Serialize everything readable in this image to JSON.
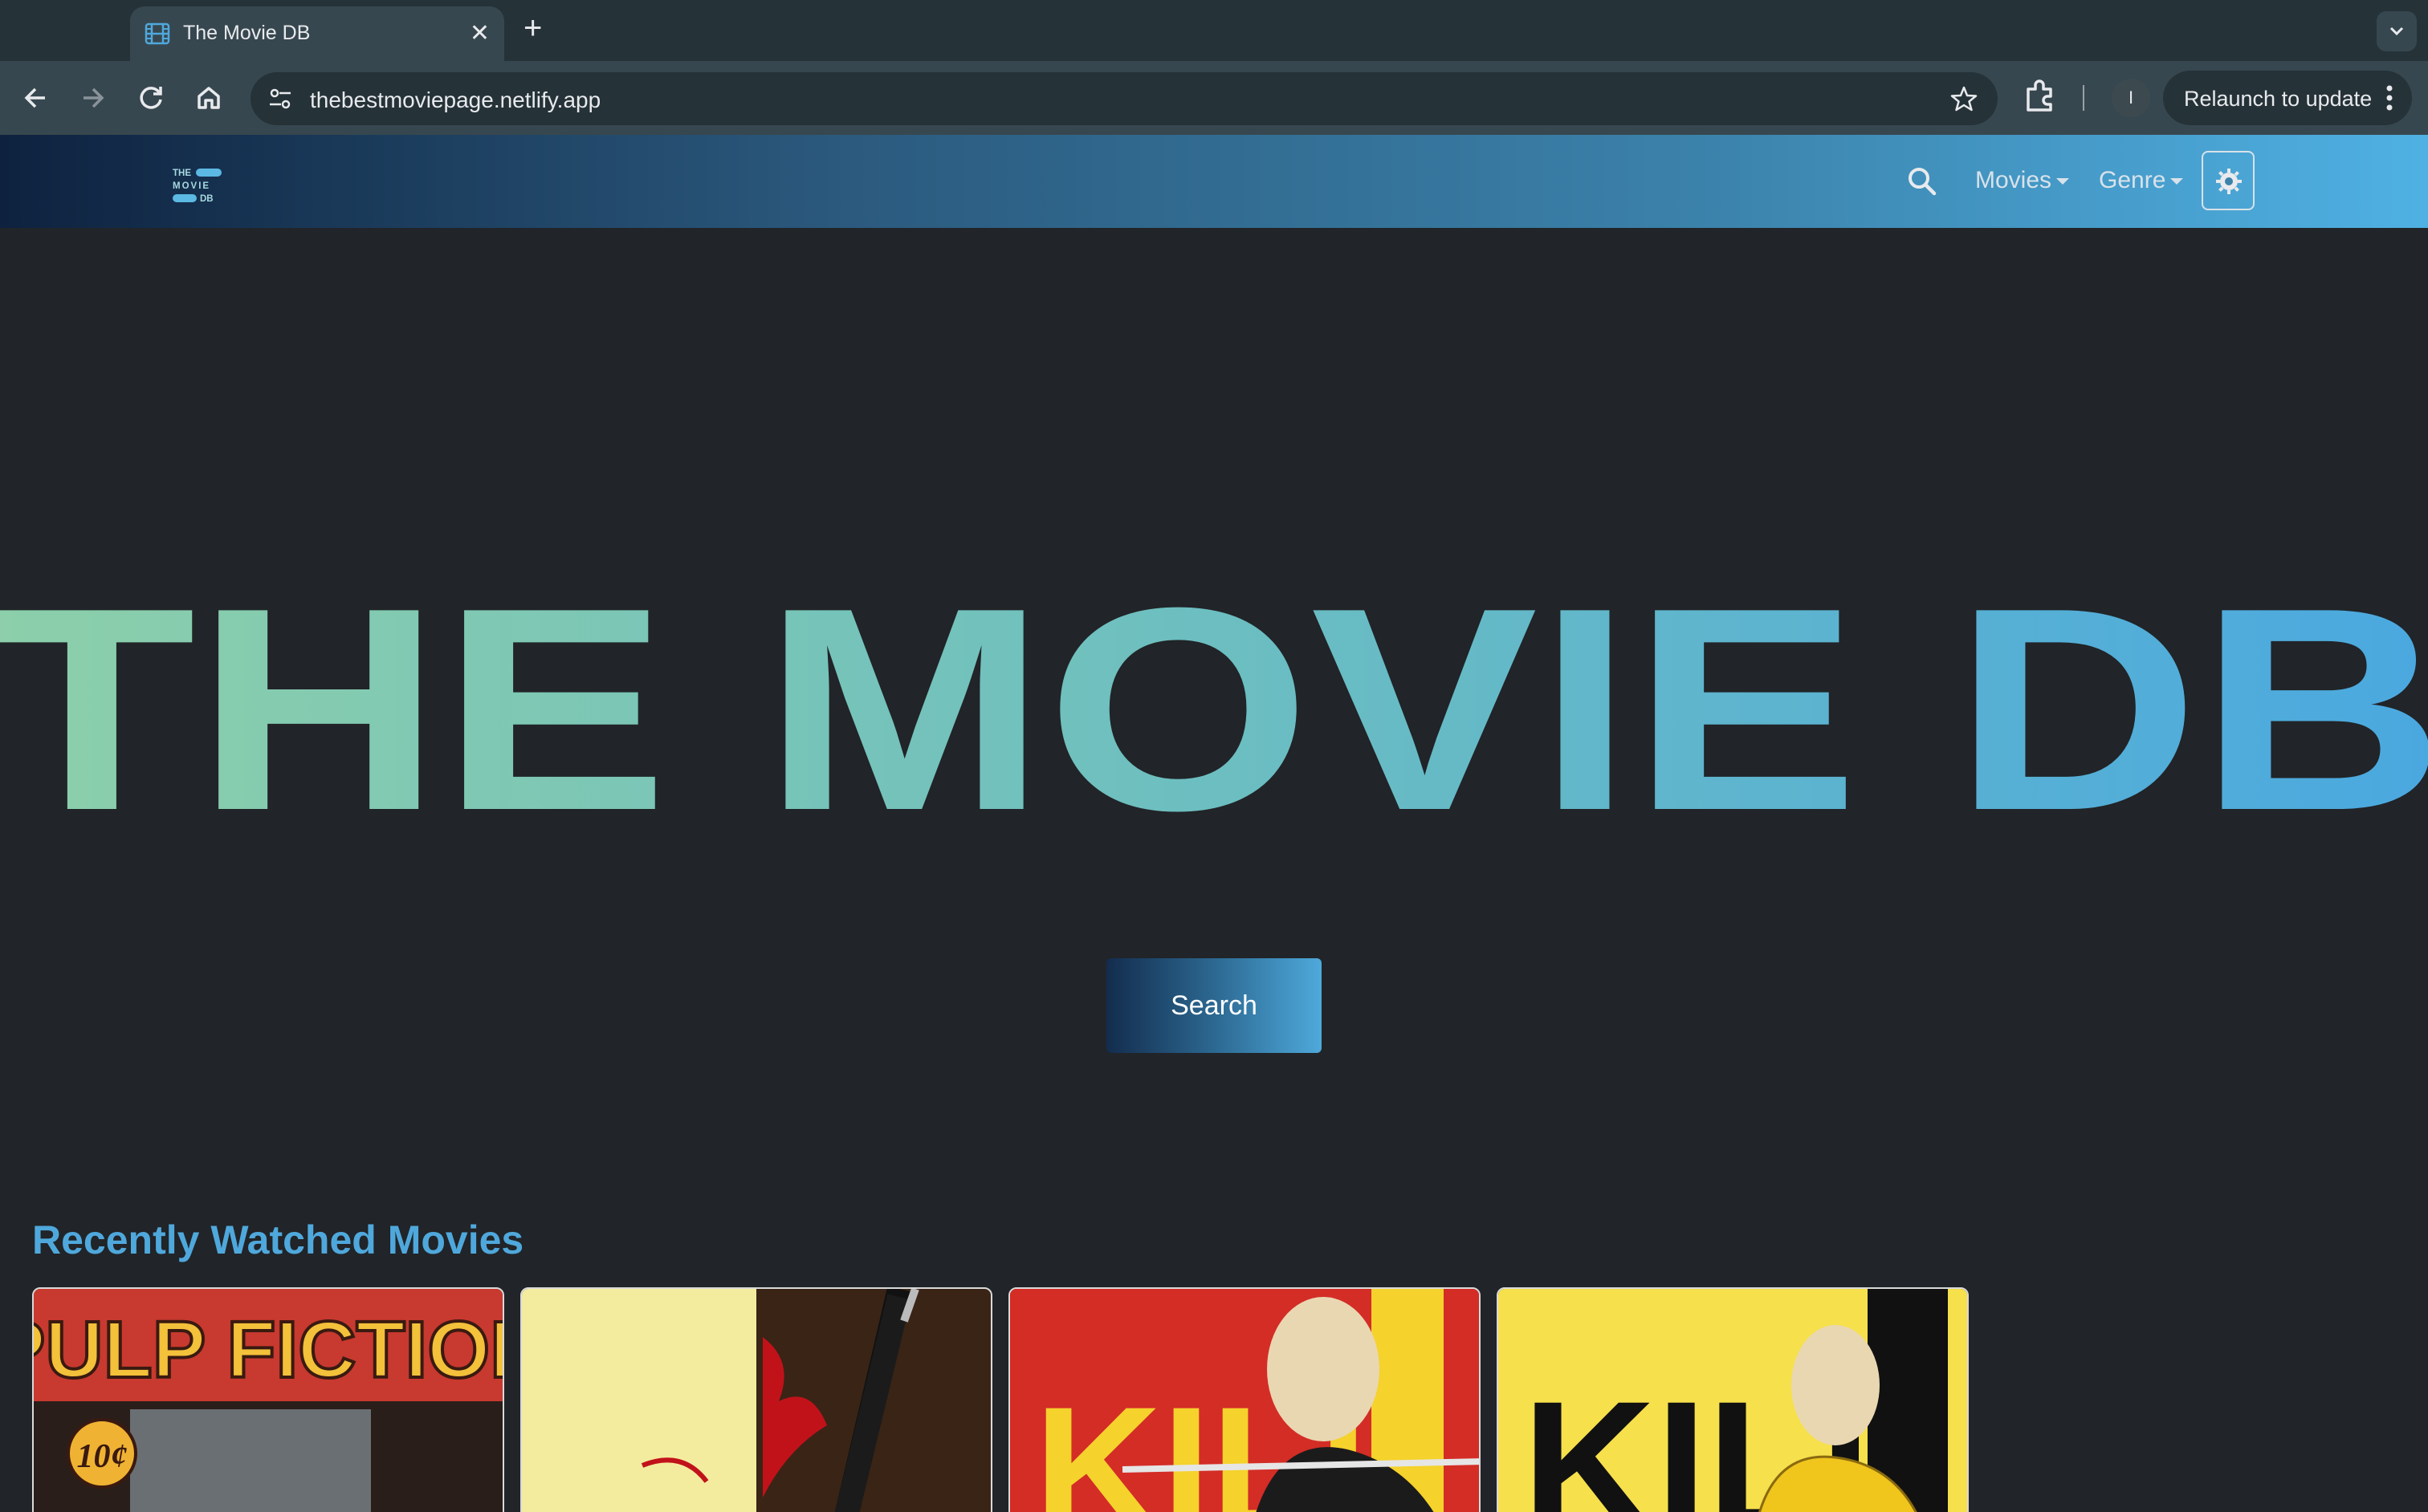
{
  "browser": {
    "tab_title": "The Movie DB",
    "url": "thebestmoviepage.netlify.app",
    "profile_initial": "I",
    "relaunch_label": "Relaunch to update"
  },
  "navbar": {
    "brand_lines": [
      "THE",
      "MOVIE",
      "DB"
    ],
    "movies_label": "Movies",
    "genre_label": "Genre"
  },
  "hero": {
    "title": "THE MOVIE DB",
    "search_label": "Search"
  },
  "recent": {
    "heading": "Recently Watched Movies",
    "posters": [
      {
        "title_art": "PULP FICTION",
        "price_art": "10¢"
      },
      {
        "title_art": ""
      },
      {
        "title_art": "KILL"
      },
      {
        "title_art": "KILL"
      }
    ]
  },
  "colors": {
    "accent": "#4fa8dc",
    "hero_gradient": [
      "#8ccfaa",
      "#6cbec0",
      "#4aa8e0"
    ],
    "navbar_gradient": [
      "#0e223f",
      "#4fb1e3"
    ],
    "page_bg": "#212428"
  }
}
